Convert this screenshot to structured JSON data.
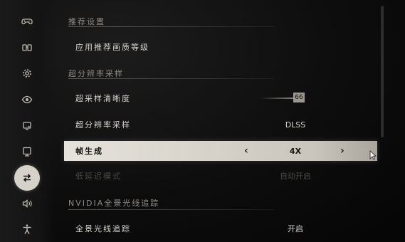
{
  "sidebar": {
    "items": [
      {
        "icon": "gamepad-icon",
        "active": false
      },
      {
        "icon": "glasses-icon",
        "active": false
      },
      {
        "icon": "gear-icon",
        "active": false
      },
      {
        "icon": "eye-icon",
        "active": false
      },
      {
        "icon": "display-icon",
        "active": false
      },
      {
        "icon": "monitor-icon",
        "active": false
      },
      {
        "icon": "graphics-settings-icon",
        "active": true
      },
      {
        "icon": "speaker-icon",
        "active": false
      },
      {
        "icon": "accessibility-icon",
        "active": false
      }
    ]
  },
  "sections": {
    "recommended": {
      "title": "推荐设置"
    },
    "upscaling": {
      "title": "超分辨率采样"
    },
    "ray_tracing": {
      "title": "NVIDIA全景光线追踪"
    }
  },
  "rows": {
    "apply_quality": {
      "label": "应用推荐画质等级"
    },
    "sharpness": {
      "label": "超采样清晰度",
      "value": "66"
    },
    "upscaler": {
      "label": "超分辨率采样",
      "value": "DLSS"
    },
    "frame_gen": {
      "label": "帧生成",
      "value": "4X"
    },
    "low_latency": {
      "label": "低延迟模式",
      "value": "自动开启"
    },
    "path_tracing": {
      "label": "全景光线追踪",
      "value": "开启"
    }
  },
  "colors": {
    "highlight": "#dcd8d0",
    "background": "#0d0d0d",
    "text": "#d8d4cc"
  }
}
